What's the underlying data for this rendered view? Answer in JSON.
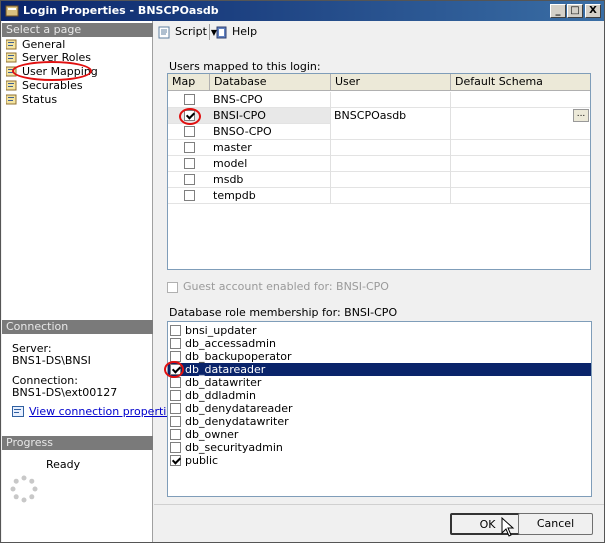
{
  "window": {
    "title": "Login Properties - BNSCPOasdb"
  },
  "left_pane": {
    "select_header": "Select a page",
    "pages": [
      {
        "label": "General"
      },
      {
        "label": "Server Roles"
      },
      {
        "label": "User Mapping"
      },
      {
        "label": "Securables"
      },
      {
        "label": "Status"
      }
    ],
    "connection_header": "Connection",
    "server_label": "Server:",
    "server_value": "BNS1-DS\\BNSI",
    "connection_label": "Connection:",
    "connection_value": "BNS1-DS\\ext00127",
    "view_connection_link": "View connection properties",
    "progress_header": "Progress",
    "progress_status": "Ready"
  },
  "toolbar": {
    "script_label": "Script",
    "help_label": "Help"
  },
  "users_mapped": {
    "label": "Users mapped to this login:",
    "columns": [
      "Map",
      "Database",
      "User",
      "Default Schema"
    ],
    "rows": [
      {
        "map": false,
        "database": "BNS-CPO",
        "user": "",
        "schema": ""
      },
      {
        "map": true,
        "database": "BNSI-CPO",
        "user": "BNSCPOasdb",
        "schema": "",
        "selected": true
      },
      {
        "map": false,
        "database": "BNSO-CPO",
        "user": "",
        "schema": ""
      },
      {
        "map": false,
        "database": "master",
        "user": "",
        "schema": ""
      },
      {
        "map": false,
        "database": "model",
        "user": "",
        "schema": ""
      },
      {
        "map": false,
        "database": "msdb",
        "user": "",
        "schema": ""
      },
      {
        "map": false,
        "database": "tempdb",
        "user": "",
        "schema": ""
      }
    ],
    "ellipsis": "..."
  },
  "guest_account_label": "Guest account enabled for: BNSI-CPO",
  "role_membership": {
    "label": "Database role membership for: BNSI-CPO",
    "roles": [
      {
        "name": "bnsi_updater",
        "checked": false
      },
      {
        "name": "db_accessadmin",
        "checked": false
      },
      {
        "name": "db_backupoperator",
        "checked": false
      },
      {
        "name": "db_datareader",
        "checked": true,
        "selected": true
      },
      {
        "name": "db_datawriter",
        "checked": false
      },
      {
        "name": "db_ddladmin",
        "checked": false
      },
      {
        "name": "db_denydatareader",
        "checked": false
      },
      {
        "name": "db_denydatawriter",
        "checked": false
      },
      {
        "name": "db_owner",
        "checked": false
      },
      {
        "name": "db_securityadmin",
        "checked": false
      },
      {
        "name": "public",
        "checked": true
      }
    ]
  },
  "buttons": {
    "ok_label": "OK",
    "cancel_label": "Cancel"
  },
  "title_buttons": {
    "minimize": "_",
    "maximize": "□",
    "close": "X"
  }
}
